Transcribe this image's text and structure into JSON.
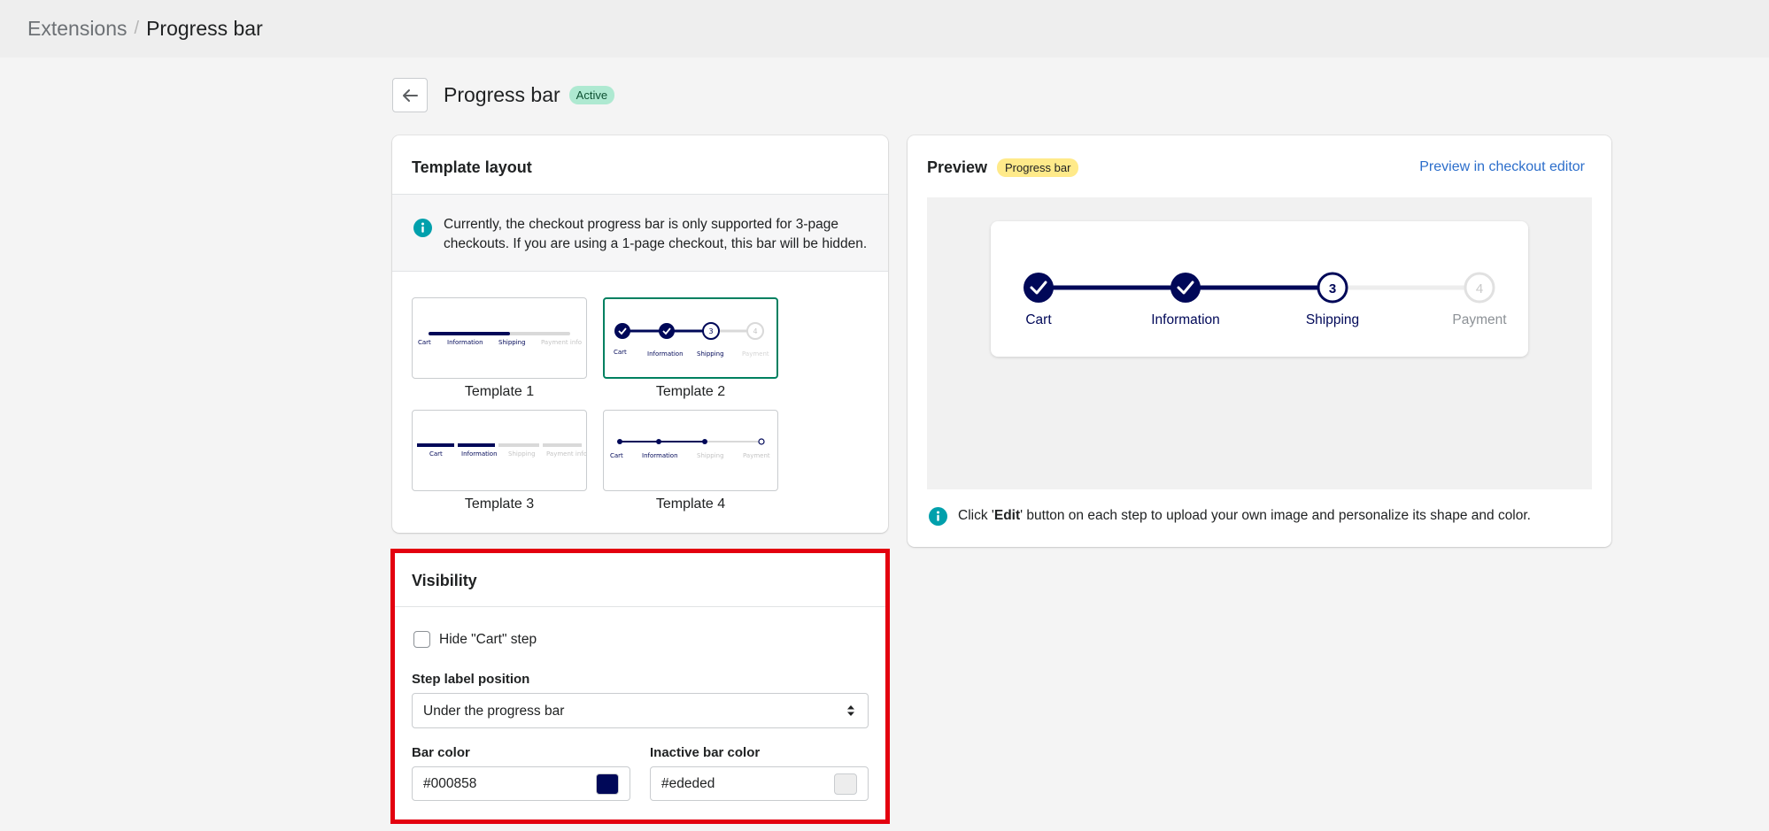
{
  "breadcrumb": {
    "parent": "Extensions",
    "separator": "/",
    "current": "Progress bar"
  },
  "page": {
    "title": "Progress bar",
    "status": "Active",
    "back_icon": "arrow-left-icon"
  },
  "template_layout": {
    "title": "Template layout",
    "info": "Currently, the checkout progress bar is only supported for 3-page checkouts. If you are using a 1-page checkout, this bar will be hidden.",
    "templates": [
      {
        "label": "Template 1",
        "steps": [
          "Cart",
          "Information",
          "Shipping",
          "Payment info"
        ],
        "selected": false
      },
      {
        "label": "Template 2",
        "steps": [
          "Cart",
          "Information",
          "Shipping",
          "Payment"
        ],
        "selected": true
      },
      {
        "label": "Template 3",
        "steps": [
          "Cart",
          "Information",
          "Shipping",
          "Payment info"
        ],
        "selected": false
      },
      {
        "label": "Template 4",
        "steps": [
          "Cart",
          "Information",
          "Shipping",
          "Payment"
        ],
        "selected": false
      }
    ]
  },
  "preview": {
    "title": "Preview",
    "badge": "Progress bar",
    "link": "Preview in checkout editor",
    "steps": [
      {
        "label": "Cart",
        "state": "done"
      },
      {
        "label": "Information",
        "state": "done"
      },
      {
        "label": "Shipping",
        "state": "current",
        "number": "3"
      },
      {
        "label": "Payment",
        "state": "inactive",
        "number": "4"
      }
    ],
    "note_prefix": "Click '",
    "note_bold": "Edit",
    "note_suffix": "' button on each step to upload your own image and personalize its shape and color."
  },
  "visibility": {
    "title": "Visibility",
    "hide_cart_label": "Hide \"Cart\" step",
    "hide_cart_checked": false,
    "step_label_position_label": "Step label position",
    "step_label_position_value": "Under the progress bar",
    "bar_color_label": "Bar color",
    "bar_color_value": "#000858",
    "inactive_bar_color_label": "Inactive bar color",
    "inactive_bar_color_value": "#ededed"
  },
  "colors": {
    "bar": "#000858",
    "inactive": "#ededed",
    "accent_green": "#008060",
    "link": "#2c6ecb",
    "highlight": "#e3000f"
  }
}
